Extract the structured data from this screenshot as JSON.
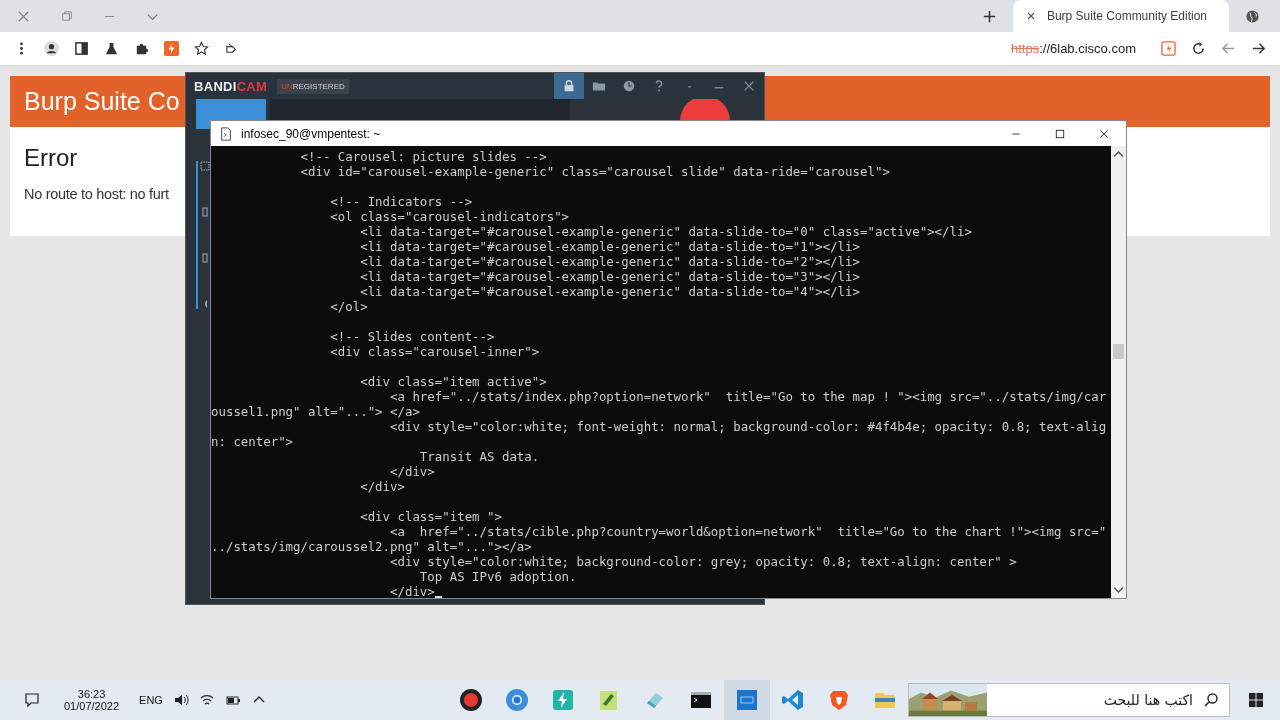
{
  "browser": {
    "tab": {
      "title": "Burp Suite Community Edition",
      "selected": true
    },
    "address": {
      "scheme": "https",
      "rest": "://6lab.cisco.com",
      "insecure": true
    }
  },
  "page": {
    "header": "Burp Suite Co",
    "heading": "Error",
    "message": "No route to host: no furt"
  },
  "bandicam": {
    "logo": [
      "BANDI",
      "CAM"
    ],
    "badge": [
      "UN",
      "REGISTERED"
    ]
  },
  "terminal": {
    "title": "infosec_90@vmpentest: ~",
    "cursor": true,
    "blocks": [
      {
        "lines": [
          "            <!-- Carousel: picture slides -->",
          "            <div id=\"carousel-example-generic\" class=\"carousel slide\" data-ride=\"carousel\">"
        ]
      },
      {
        "lines": [
          "                <!-- Indicators -->",
          "                <ol class=\"carousel-indicators\">",
          "                    <li data-target=\"#carousel-example-generic\" data-slide-to=\"0\" class=\"active\"></li>",
          "                    <li data-target=\"#carousel-example-generic\" data-slide-to=\"1\"></li>",
          "                    <li data-target=\"#carousel-example-generic\" data-slide-to=\"2\"></li>",
          "                    <li data-target=\"#carousel-example-generic\" data-slide-to=\"3\"></li>",
          "                    <li data-target=\"#carousel-example-generic\" data-slide-to=\"4\"></li>",
          "                </ol>"
        ]
      },
      {
        "lines": [
          "                <!-- Slides content-->",
          "                <div class=\"carousel-inner\">"
        ]
      },
      {
        "lines": [
          "                    <div class=\"item active\">",
          "                        <a href=\"../stats/index.php?option=network\"  title=\"Go to the map ! \"><img src=\"../stats/img/car",
          "oussel1.png\" alt=\"...\"> </a>",
          "                        <div style=\"color:white; font-weight: normal; background-color: #4f4b4e; opacity: 0.8; text-alig",
          "n: center\">",
          "                            Transit AS data.",
          "                        </div>",
          "                    </div>"
        ]
      },
      {
        "lines": [
          "                    <div class=\"item \">",
          "                        <a  href=\"../stats/cible.php?country=world&option=network\"  title=\"Go to the chart !\"><img src=\"",
          "../stats/img/caroussel2.png\" alt=\"...\"></a>",
          "                        <div style=\"color:white; background-color: grey; opacity: 0.8; text-align: center\" >",
          "                            Top AS IPv6 adoption.",
          "                        </div>"
        ]
      }
    ]
  },
  "taskbar": {
    "time": "36:23",
    "date": "01/07/2022",
    "language": "ENG",
    "apps": [
      {
        "kind": "record",
        "selected": false
      },
      {
        "kind": "chrome",
        "selected": false
      },
      {
        "kind": "bolt",
        "selected": false
      },
      {
        "kind": "notepad",
        "selected": false
      },
      {
        "kind": "eraser",
        "selected": false
      },
      {
        "kind": "terminal",
        "selected": false
      },
      {
        "kind": "bandicam",
        "selected": true
      },
      {
        "kind": "vscode",
        "selected": false
      },
      {
        "kind": "brave",
        "selected": false
      },
      {
        "kind": "folder",
        "selected": false
      }
    ],
    "search": {
      "placeholder": "اكتب هنا للبحث"
    }
  }
}
